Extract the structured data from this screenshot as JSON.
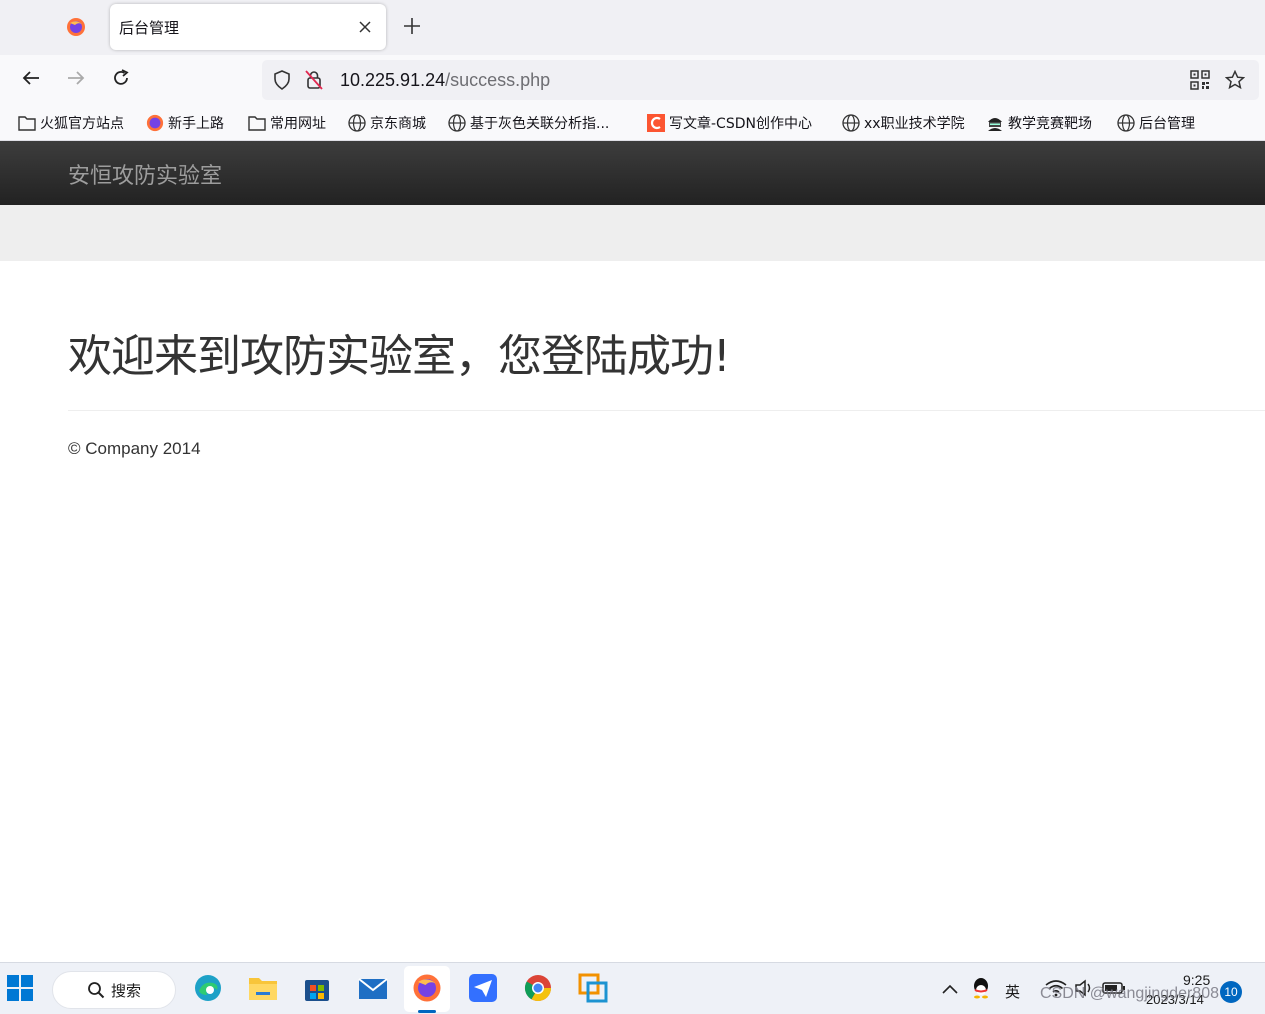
{
  "browser": {
    "active_tab_title": "后台管理",
    "url_host": "10.225.91.24",
    "url_path": "/success.php"
  },
  "bookmarks": [
    {
      "label": "火狐官方站点",
      "icon": "folder-icon"
    },
    {
      "label": "新手上路",
      "icon": "firefox-icon"
    },
    {
      "label": "常用网址",
      "icon": "folder-icon"
    },
    {
      "label": "京东商城",
      "icon": "globe-icon"
    },
    {
      "label": "基于灰色关联分析指...",
      "icon": "globe-icon"
    },
    {
      "label": "写文章-CSDN创作中心",
      "icon": "csdn-icon"
    },
    {
      "label": "xx职业技术学院",
      "icon": "globe-icon"
    },
    {
      "label": "教学竞赛靶场",
      "icon": "hacker-icon"
    },
    {
      "label": "后台管理",
      "icon": "globe-icon"
    }
  ],
  "page": {
    "brand": "安恒攻防实验室",
    "welcome": "欢迎来到攻防实验室，您登陆成功!",
    "footer": "© Company 2014"
  },
  "taskbar": {
    "search_label": "搜索",
    "ime": "英",
    "time": "9:25",
    "date": "2023/3/14",
    "notification_count": "10",
    "watermark": "CSDN @wangjingder808"
  },
  "colors": {
    "header_bg": "#2b2b2b",
    "brand_text": "#9d9d9d",
    "band_bg": "#eeeeee",
    "accent": "#0067c0"
  }
}
